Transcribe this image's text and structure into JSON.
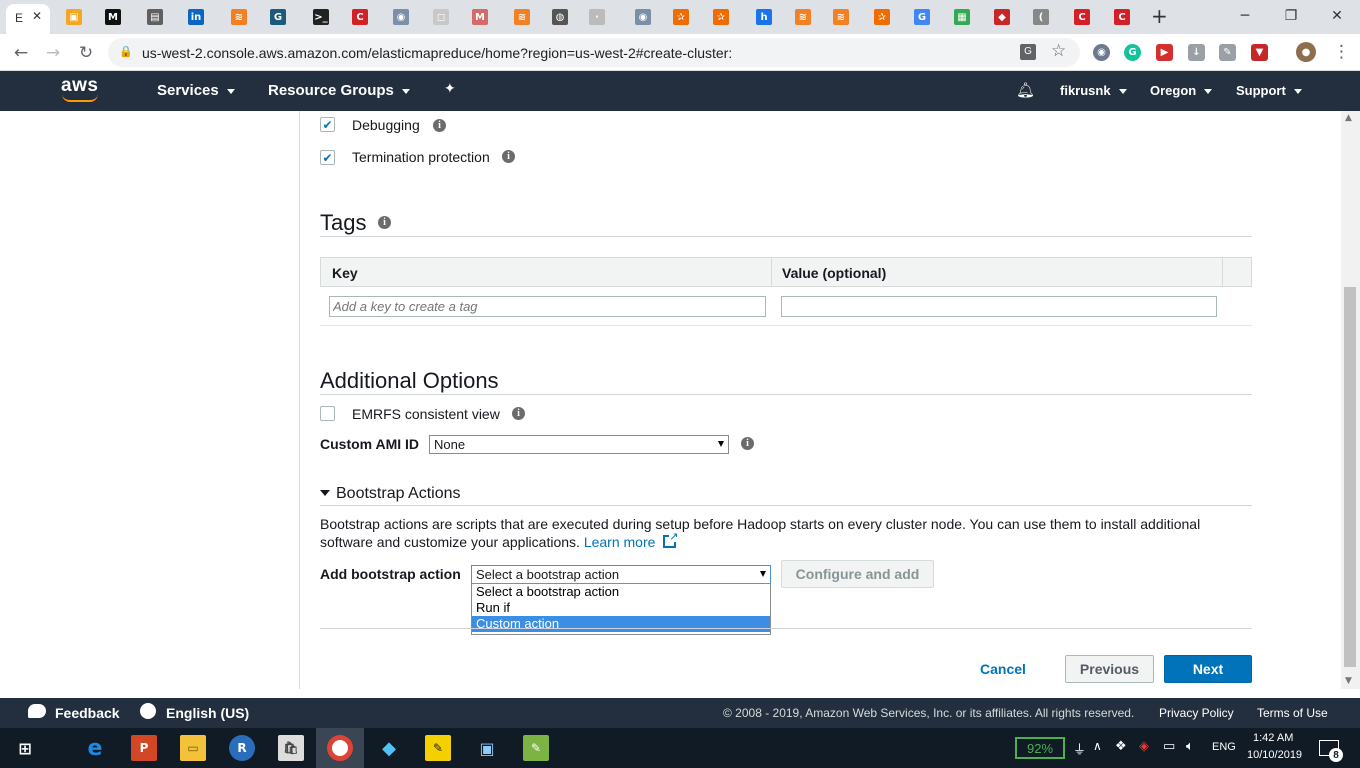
{
  "browser": {
    "active_tab_label": "E",
    "url": "us-west-2.console.aws.amazon.com/elasticmapreduce/home?region=us-west-2#create-cluster:",
    "new_tab": "+",
    "win_minimize": "─",
    "win_restore": "❐",
    "win_close": "✕",
    "back": "←",
    "forward": "→",
    "reload": "↻",
    "lock": "🔒",
    "star": "☆",
    "menu": "⋮",
    "tab_favicons": [
      {
        "glyph": "▣",
        "color": "#f5a623",
        "name": "cube-favicon"
      },
      {
        "glyph": "M",
        "color": "#111111",
        "name": "medium-favicon"
      },
      {
        "glyph": "▤",
        "color": "#606060",
        "name": "doc-favicon"
      },
      {
        "glyph": "in",
        "color": "#0a66c2",
        "name": "linkedin-favicon"
      },
      {
        "glyph": "≋",
        "color": "#f48024",
        "name": "stackoverflow-favicon"
      },
      {
        "glyph": "G",
        "color": "#1b5a7a",
        "name": "g-favicon"
      },
      {
        "glyph": ">_",
        "color": "#222222",
        "name": "terminal-favicon"
      },
      {
        "glyph": "C",
        "color": "#d31f26",
        "name": "c-favicon"
      },
      {
        "glyph": "◉",
        "color": "#7b8fa6",
        "name": "circle-favicon"
      },
      {
        "glyph": "◻",
        "color": "#c8c8c8",
        "name": "box-favicon"
      },
      {
        "glyph": "M",
        "color": "#d46a6a",
        "name": "gmail-favicon"
      },
      {
        "glyph": "≋",
        "color": "#f48024",
        "name": "stackoverflow-favicon-2"
      },
      {
        "glyph": "◍",
        "color": "#555555",
        "name": "github-favicon"
      },
      {
        "glyph": "·",
        "color": "#bbbbbb",
        "name": "blank-favicon"
      },
      {
        "glyph": "◉",
        "color": "#7b8fa6",
        "name": "circle-favicon-2"
      },
      {
        "glyph": "✰",
        "color": "#ef6c00",
        "name": "star-favicon"
      },
      {
        "glyph": "✰",
        "color": "#ef6c00",
        "name": "star-favicon-2"
      },
      {
        "glyph": "h",
        "color": "#1a73e8",
        "name": "h-favicon"
      },
      {
        "glyph": "≋",
        "color": "#f48024",
        "name": "stackoverflow-favicon-3"
      },
      {
        "glyph": "≋",
        "color": "#f48024",
        "name": "stackoverflow-favicon-4"
      },
      {
        "glyph": "✰",
        "color": "#ef6c00",
        "name": "star-favicon-3"
      },
      {
        "glyph": "G",
        "color": "#4285f4",
        "name": "google-favicon"
      },
      {
        "glyph": "▦",
        "color": "#34a853",
        "name": "office-favicon"
      },
      {
        "glyph": "◆",
        "color": "#c62828",
        "name": "flag-favicon"
      },
      {
        "glyph": "(",
        "color": "#888888",
        "name": "audio-favicon"
      },
      {
        "glyph": "C",
        "color": "#d31f26",
        "name": "c-favicon-2"
      },
      {
        "glyph": "C",
        "color": "#d31f26",
        "name": "c-favicon-3"
      }
    ]
  },
  "aws_nav": {
    "logo": "aws",
    "services": "Services",
    "resource_groups": "Resource Groups",
    "pin": "📌",
    "bell": "🔔",
    "user": "fikrusnk",
    "region": "Oregon",
    "support": "Support"
  },
  "cluster_options": {
    "debugging_label": "Debugging",
    "termination_label": "Termination protection",
    "info": "i"
  },
  "tags": {
    "heading": "Tags",
    "col_key": "Key",
    "col_value": "Value (optional)",
    "key_placeholder": "Add a key to create a tag",
    "value_placeholder": ""
  },
  "additional": {
    "heading": "Additional Options",
    "emrfs_label": "EMRFS consistent view",
    "ami_label": "Custom AMI ID",
    "ami_value": "None"
  },
  "bootstrap": {
    "heading": "Bootstrap Actions",
    "toggle": "▾",
    "description": "Bootstrap actions are scripts that are executed during setup before Hadoop starts on every cluster node. You can use them to install additional software and customize your applications.",
    "learn_more": "Learn more",
    "add_label": "Add bootstrap action",
    "select_value": "Select a bootstrap action",
    "options": [
      "Select a bootstrap action",
      "Run if",
      "Custom action"
    ],
    "configure_button": "Configure and add"
  },
  "actions": {
    "cancel": "Cancel",
    "previous": "Previous",
    "next": "Next"
  },
  "footer": {
    "feedback": "Feedback",
    "language": "English (US)",
    "copyright": "© 2008 - 2019, Amazon Web Services, Inc. or its affiliates. All rights reserved.",
    "privacy": "Privacy Policy",
    "terms": "Terms of Use"
  },
  "taskbar": {
    "battery": "92%",
    "lang": "ENG",
    "time": "1:42 AM",
    "date": "10/10/2019",
    "notifications": "8"
  },
  "colors": {
    "aws_dark": "#232f3e",
    "primary_blue": "#0073bb",
    "select_highlight": "#3b8ee3"
  }
}
